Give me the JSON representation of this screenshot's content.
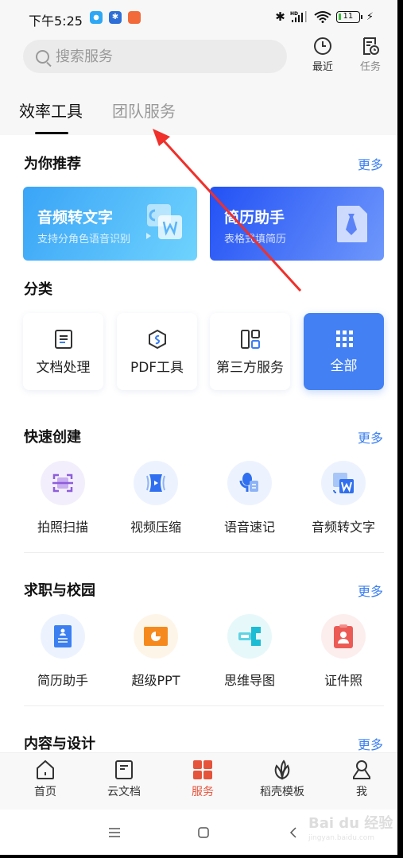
{
  "status_bar": {
    "time": "下午5:25",
    "battery": "11",
    "signal_label": "HD",
    "app_icons": [
      "chat-app-icon",
      "bluetooth-app-icon",
      "store-app-icon"
    ],
    "right_icons": [
      "bluetooth-icon",
      "signal-icon",
      "wifi-icon",
      "battery-icon",
      "charging-icon"
    ]
  },
  "header": {
    "search_placeholder": "搜索服务",
    "actions": [
      {
        "label": "最近",
        "icon": "clock-icon"
      },
      {
        "label": "任务",
        "icon": "task-icon"
      }
    ]
  },
  "tabs": [
    {
      "label": "效率工具",
      "active": true
    },
    {
      "label": "团队服务",
      "active": false
    }
  ],
  "recommend": {
    "title": "为你推荐",
    "more": "更多",
    "banners": [
      {
        "title": "音频转文字",
        "subtitle": "支持分角色语音识别",
        "icon": "audio-to-word-icon"
      },
      {
        "title": "简历助手",
        "subtitle": "表格式填简历",
        "icon": "resume-tie-icon"
      }
    ]
  },
  "category": {
    "title": "分类",
    "items": [
      {
        "label": "文档处理",
        "icon": "document-icon"
      },
      {
        "label": "PDF工具",
        "icon": "pdf-icon"
      },
      {
        "label": "第三方服务",
        "icon": "layout-icon"
      },
      {
        "label": "全部",
        "icon": "grid-icon",
        "active": true
      }
    ]
  },
  "quick_create": {
    "title": "快速创建",
    "more": "更多",
    "items": [
      {
        "label": "拍照扫描",
        "icon": "scan-icon"
      },
      {
        "label": "视频压缩",
        "icon": "video-compress-icon"
      },
      {
        "label": "语音速记",
        "icon": "voice-note-icon"
      },
      {
        "label": "音频转文字",
        "icon": "audio-to-word-icon"
      }
    ]
  },
  "career": {
    "title": "求职与校园",
    "more": "更多",
    "items": [
      {
        "label": "简历助手",
        "icon": "resume-icon"
      },
      {
        "label": "超级PPT",
        "icon": "ppt-icon"
      },
      {
        "label": "思维导图",
        "icon": "mindmap-icon"
      },
      {
        "label": "证件照",
        "icon": "id-photo-icon"
      }
    ]
  },
  "content_design": {
    "title": "内容与设计",
    "more": "更多"
  },
  "bottom_nav": [
    {
      "label": "首页",
      "icon": "home-icon"
    },
    {
      "label": "云文档",
      "icon": "cloud-doc-icon"
    },
    {
      "label": "服务",
      "icon": "services-icon",
      "active": true
    },
    {
      "label": "稻壳模板",
      "icon": "template-leaf-icon"
    },
    {
      "label": "我",
      "icon": "profile-icon"
    }
  ],
  "watermark": {
    "text": "Bai du 经验",
    "sub": "jingyan.baidu.com"
  },
  "colors": {
    "accent": "#3b7ff1",
    "active_nav": "#e6533b",
    "annotation_arrow": "#f0302a"
  }
}
